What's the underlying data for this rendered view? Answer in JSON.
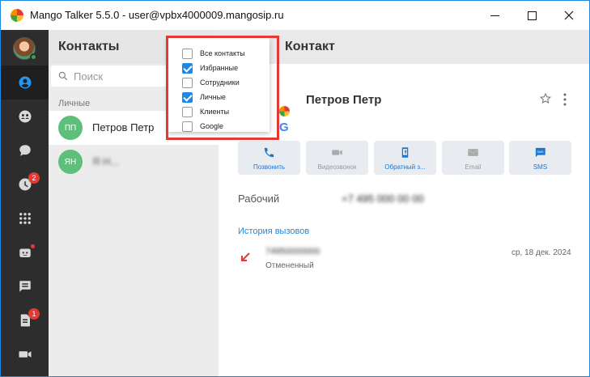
{
  "window": {
    "title": "Mango Talker 5.5.0 - user@vpbx4000009.mangosip.ru",
    "min_symbol": "",
    "close_icon": "close-icon"
  },
  "nav": {
    "items": [
      {
        "name": "contacts",
        "icon": "person-icon",
        "active": true
      },
      {
        "name": "groups",
        "icon": "group-icon"
      },
      {
        "name": "chats",
        "icon": "chat-icon"
      },
      {
        "name": "history",
        "icon": "clock-icon",
        "badge": "2"
      },
      {
        "name": "dialpad",
        "icon": "dialpad-icon"
      },
      {
        "name": "bot",
        "icon": "bot-icon",
        "dot": true
      },
      {
        "name": "messages",
        "icon": "message-list-icon"
      },
      {
        "name": "tasks",
        "icon": "document-icon",
        "badge": "1"
      },
      {
        "name": "video",
        "icon": "video-icon"
      }
    ]
  },
  "contacts": {
    "title": "Контакты",
    "search_placeholder": "Поиск",
    "section_label": "Личные",
    "list": [
      {
        "initials": "ПП",
        "name": "Петров Петр",
        "selected": true
      },
      {
        "initials": "ЯН",
        "name": "Я Н...",
        "blurred": true
      }
    ]
  },
  "filter_menu": {
    "options": [
      {
        "label": "Все контакты",
        "checked": false
      },
      {
        "label": "Избранные",
        "checked": true
      },
      {
        "label": "Сотрудники",
        "checked": false
      },
      {
        "label": "Личные",
        "checked": true
      },
      {
        "label": "Клиенты",
        "checked": false
      },
      {
        "label": "Google",
        "checked": false
      }
    ],
    "highlight_color": "#e53935"
  },
  "detail": {
    "header_title": "Контакт",
    "name": "Петров Петр",
    "google_letter": "G",
    "actions": [
      {
        "label": "Позвонить",
        "icon": "phone-icon",
        "enabled": true
      },
      {
        "label": "Видеозвонок",
        "icon": "videocam-icon",
        "enabled": false
      },
      {
        "label": "Обратный з...",
        "icon": "callback-icon",
        "enabled": true
      },
      {
        "label": "Email",
        "icon": "email-icon",
        "enabled": false
      },
      {
        "label": "SMS",
        "icon": "sms-icon",
        "enabled": true
      }
    ],
    "phone_label": "Рабочий",
    "phone_value": "+7 495 000 00 00",
    "history_title": "История вызовов",
    "history": [
      {
        "number": "74950000000",
        "status": "Отмененный",
        "date": "ср, 18 дек. 2024"
      }
    ]
  },
  "colors": {
    "accent": "#1e88e5",
    "nav_bg": "#2d2d2d",
    "badge": "#e53935",
    "avatar": "#5cbf7a"
  }
}
